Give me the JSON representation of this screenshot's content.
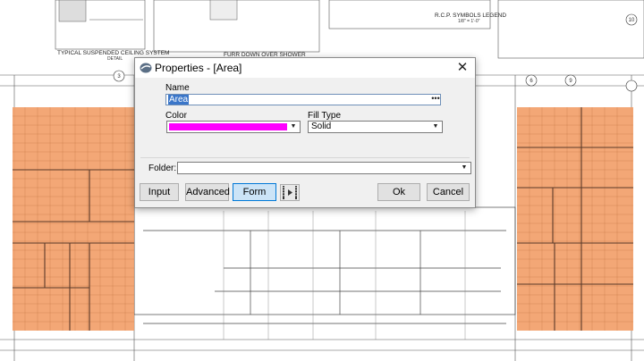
{
  "dialog": {
    "title": "Properties - [Area]",
    "close_glyph": "✕",
    "name_label": "Name",
    "name_value": "Area",
    "name_more": "•••",
    "color_label": "Color",
    "color_value": "#ff00ff",
    "fill_type_label": "Fill Type",
    "fill_type_value": "Solid",
    "folder_label": "Folder:",
    "folder_value": "",
    "buttons": {
      "input": "Input",
      "advanced": "Advanced",
      "form": "Form",
      "ok": "Ok",
      "cancel": "Cancel"
    },
    "icons": {
      "app": "app-logo-icon",
      "filmstrip": "filmstrip-icon",
      "dropdown": "chevron-down-icon"
    }
  },
  "drawing": {
    "area_fill": "#f2a06a",
    "notes": {
      "ceiling_detail": "TYPICAL SUSPENDED CEILING SYSTEM",
      "ceiling_detail_sub": "DETAIL",
      "furr_down": "FURR DOWN OVER SHOWER",
      "legend": "R.C.P. SYMBOLS LEGEND",
      "legend_scale": "1/8\" = 1'-0\""
    },
    "grid_markers": [
      "3",
      "6",
      "9",
      "10"
    ]
  }
}
